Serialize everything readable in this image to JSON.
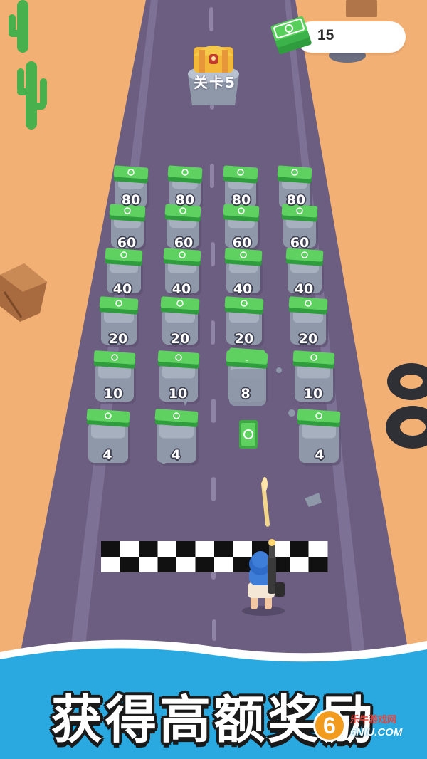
{
  "hud": {
    "cash_amount": "15",
    "icon": "cash-stack-icon"
  },
  "level": {
    "label": "关卡5"
  },
  "blocks": {
    "row80": [
      "80",
      "80",
      "80",
      "80"
    ],
    "row60": [
      "60",
      "60",
      "60",
      "60"
    ],
    "row40": [
      "40",
      "40",
      "40",
      "40"
    ],
    "row20": [
      "20",
      "20",
      "20",
      "20"
    ],
    "row10": [
      "10",
      "10",
      "8",
      "10"
    ],
    "row4": [
      "4",
      "4",
      "4"
    ]
  },
  "banner": {
    "text": "获得高额奖励",
    "color": "#29a9e0"
  },
  "watermark": {
    "badge": "6",
    "site": "乐牛游戏网",
    "domain": "6NIU.COM"
  },
  "colors": {
    "sand": "#f2b074",
    "road": "#6b5e80",
    "cash_green": "#49c64b",
    "block_gray": "#8e98a8"
  }
}
